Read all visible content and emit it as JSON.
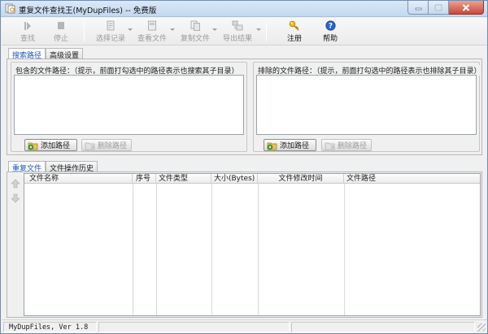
{
  "window": {
    "title": "重复文件查找王(MyDupFiles) -- 免费版"
  },
  "toolbar": {
    "find_label": "查找",
    "stop_label": "停止",
    "select_label": "选择记录",
    "view_label": "查看文件",
    "copy_label": "复制文件",
    "export_label": "导出结果",
    "register_label": "注册",
    "help_label": "帮助"
  },
  "top_tabs": [
    {
      "label": "搜索路径"
    },
    {
      "label": "高级设置"
    }
  ],
  "include_group": {
    "label": "包含的文件路径：（提示，前面打勾选中的路径表示也搜索其子目录）",
    "add_label": "添加路径",
    "remove_label": "删除路径"
  },
  "exclude_group": {
    "label": "排除的文件路径：（提示，前面打勾选中的路径表示也排除其子目录）",
    "add_label": "添加路径",
    "remove_label": "删除路径"
  },
  "bottom_tabs": [
    {
      "label": "重复文件"
    },
    {
      "label": "文件操作历史"
    }
  ],
  "results_table": {
    "columns": [
      "文件名称",
      "序号",
      "文件类型",
      "大小(Bytes)",
      "文件修改时间",
      "文件路径"
    ],
    "rows": []
  },
  "statusbar": {
    "version": "MyDupFiles, Ver 1.8"
  },
  "colors": {
    "active_tab_text": "#1f55c4",
    "close_button": "#c9473a",
    "titlebar": "#c3d8ef"
  }
}
